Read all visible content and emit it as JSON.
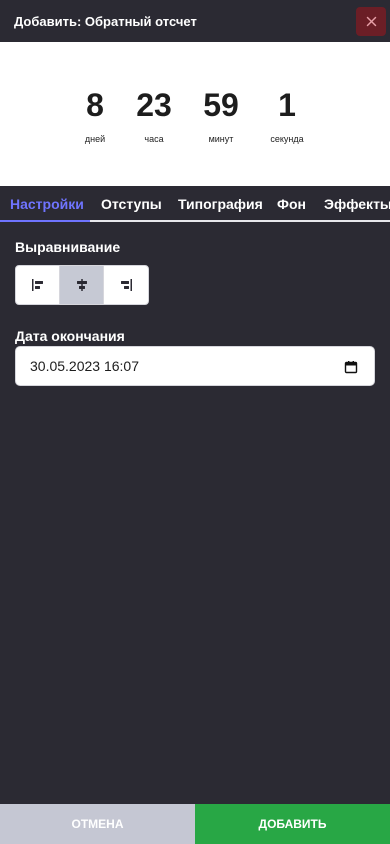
{
  "header": {
    "title": "Добавить: Обратный отсчет"
  },
  "countdown": [
    {
      "value": "8",
      "label": "дней"
    },
    {
      "value": "23",
      "label": "часа"
    },
    {
      "value": "59",
      "label": "минут"
    },
    {
      "value": "1",
      "label": "секунда"
    }
  ],
  "tabs": [
    {
      "label": "Настройки",
      "active": true
    },
    {
      "label": "Отступы"
    },
    {
      "label": "Типография"
    },
    {
      "label": "Фон"
    },
    {
      "label": "Эффекты"
    }
  ],
  "settings": {
    "alignment_label": "Выравнивание",
    "alignment_selected": "center",
    "end_date_label": "Дата окончания",
    "end_date_value": "30.05.2023 16:07"
  },
  "footer": {
    "cancel_label": "ОТМЕНА",
    "add_label": "ДОБАВИТЬ"
  },
  "colors": {
    "panel_bg": "#2b2a33",
    "accent": "#6f74ff",
    "close_bg": "#6b1e26",
    "add_bg": "#28a745",
    "cancel_bg": "#c5c7d3"
  }
}
